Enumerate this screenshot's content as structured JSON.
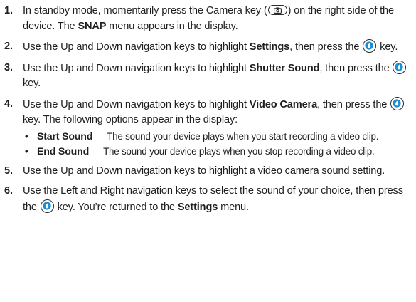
{
  "steps": [
    {
      "num": "1.",
      "t1": "In standby mode, momentarily press the Camera key (",
      "t2": ") on the right side of the device. The ",
      "b1": "SNAP",
      "t3": " menu appears in the display."
    },
    {
      "num": "2.",
      "t1": "Use the Up and Down navigation keys to highlight ",
      "b1": "Settings",
      "t2": ", then press the ",
      "t3": " key."
    },
    {
      "num": "3.",
      "t1": "Use the Up and Down navigation keys to highlight ",
      "b1": "Shutter Sound",
      "t2": ", then press the ",
      "t3": " key."
    },
    {
      "num": "4.",
      "t1": "Use the Up and Down navigation keys to highlight ",
      "b1": "Video Camera",
      "t2": ", then press the ",
      "t3": " key. The following options appear in the display:"
    },
    {
      "num": "5.",
      "t1": "Use the Up and Down navigation keys to highlight a video camera sound setting."
    },
    {
      "num": "6.",
      "t1": "Use the Left and Right navigation keys to select the sound of your choice, then press the ",
      "t2": " key. You’re returned to the ",
      "b1": "Settings",
      "t3": " menu."
    }
  ],
  "options": [
    {
      "bullet": "•",
      "label": "Start Sound",
      "desc": " — The sound your device plays when you start recording a video clip."
    },
    {
      "bullet": "•",
      "label": "End Sound",
      "desc": " — The sound your device plays when you stop recording a video clip."
    }
  ],
  "icons": {
    "ok_key": "ok-key-icon",
    "camera_key": "camera-key-icon",
    "ok_key_fill": "#1a8fd6"
  }
}
